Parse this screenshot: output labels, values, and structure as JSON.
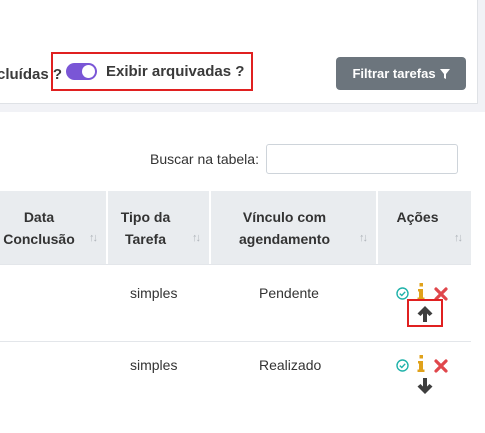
{
  "filters": {
    "cut_label": "cluídas ?",
    "archive_label": "Exibir arquivadas ?",
    "filter_button": "Filtrar tarefas",
    "toggle_state": "on",
    "accent": "#7a56d6"
  },
  "search": {
    "label": "Buscar na tabela:",
    "value": ""
  },
  "table": {
    "columns": [
      {
        "line1": "Data",
        "line2": "Conclusão"
      },
      {
        "line1": "Tipo da",
        "line2": "Tarefa"
      },
      {
        "line1": "Vínculo com",
        "line2": "agendamento"
      },
      {
        "line1": "Ações",
        "line2": ""
      }
    ],
    "rows": [
      {
        "data_conclusao": "",
        "tipo": "simples",
        "vinculo": "Pendente",
        "move_icon": "arrow-up-icon"
      },
      {
        "data_conclusao": "",
        "tipo": "simples",
        "vinculo": "Realizado",
        "move_icon": "arrow-down-icon"
      }
    ],
    "action_icons": [
      "check-circle-icon",
      "info-icon",
      "delete-x-icon"
    ]
  }
}
